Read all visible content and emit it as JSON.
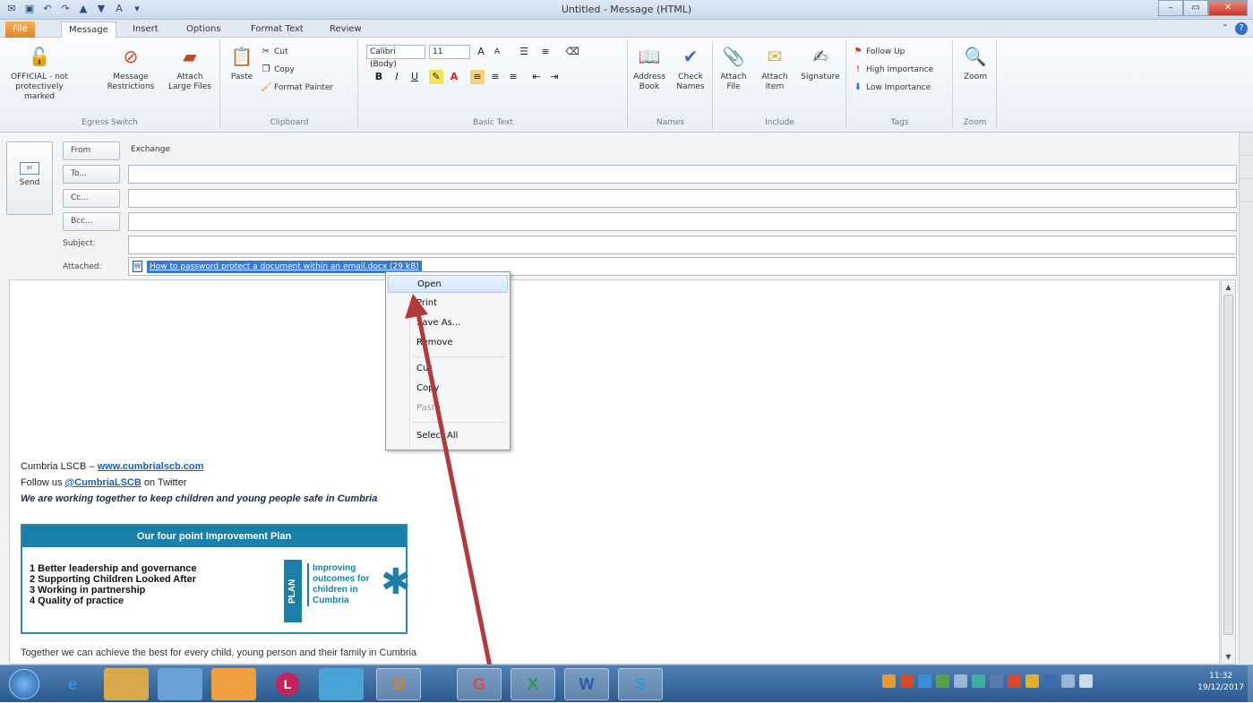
{
  "window": {
    "title": "Untitled - Message (HTML)",
    "controls": {
      "minimize": "–",
      "maximize": "▭",
      "close": "✕"
    }
  },
  "ribbon_tabs": [
    "File",
    "Message",
    "Insert",
    "Options",
    "Format Text",
    "Review"
  ],
  "active_tab": "Message",
  "ribbon": {
    "egress": {
      "button1": "OFFICIAL - not protectively marked",
      "button2": "Message Restrictions",
      "button3": "Attach Large Files",
      "group": "Egress Switch"
    },
    "clipboard": {
      "paste": "Paste",
      "cut": "Cut",
      "copy": "Copy",
      "format_painter": "Format Painter",
      "group": "Clipboard"
    },
    "basic_text": {
      "font": "Calibri (Body)",
      "size": "11",
      "group": "Basic Text"
    },
    "names": {
      "address_book": "Address Book",
      "check_names": "Check Names",
      "group": "Names"
    },
    "include": {
      "attach_file": "Attach File",
      "attach_item": "Attach Item",
      "signature": "Signature",
      "group": "Include"
    },
    "tags": {
      "follow_up": "Follow Up",
      "high_importance": "High Importance",
      "low_importance": "Low Importance",
      "group": "Tags"
    },
    "zoom": {
      "zoom": "Zoom",
      "group": "Zoom"
    }
  },
  "header": {
    "send": "Send",
    "from_label": "From",
    "from_value": "Exchange",
    "to_label": "To...",
    "cc_label": "Cc...",
    "bcc_label": "Bcc...",
    "subject_label": "Subject:",
    "attached_label": "Attached:",
    "attachment_name": "How to password protect a document within an email.docx (29 kB)"
  },
  "context_menu": {
    "items": [
      "Open",
      "Print",
      "Save As...",
      "Remove",
      "Cut",
      "Copy",
      "Paste",
      "Select All"
    ],
    "hovered": "Open",
    "disabled": [
      "Paste"
    ]
  },
  "body": {
    "sig_org": "Cumbria LSCB – ",
    "sig_url": "www.cumbrialscb.com",
    "sig_follow_prefix": "Follow us ",
    "sig_twitter": "@CumbriaLSCB",
    "sig_follow_suffix": " on Twitter",
    "sig_tagline": "We are working together to keep children and young people safe in Cumbria",
    "plan": {
      "title": "Our four point Improvement Plan",
      "items": [
        "1  Better leadership and governance",
        "2  Supporting Children Looked After",
        "3  Working in partnership",
        "4  Quality of practice"
      ],
      "tag": "PLAN",
      "words": [
        "Improving",
        "outcomes for",
        "children in",
        "Cumbria"
      ]
    },
    "footer_line": "Together we can achieve the best for every child, young person and their family in Cumbria"
  },
  "taskbar": {
    "apps": [
      "e",
      "",
      "",
      "",
      "L",
      "",
      "O",
      "G",
      "X",
      "W",
      "S"
    ],
    "clock_time": "11:32",
    "clock_date": "19/12/2017"
  },
  "colors": {
    "accent": "#2b579a",
    "file_tab": "#e2832b",
    "plan_blue": "#1a7fa9",
    "arrow": "#b23a3a"
  }
}
